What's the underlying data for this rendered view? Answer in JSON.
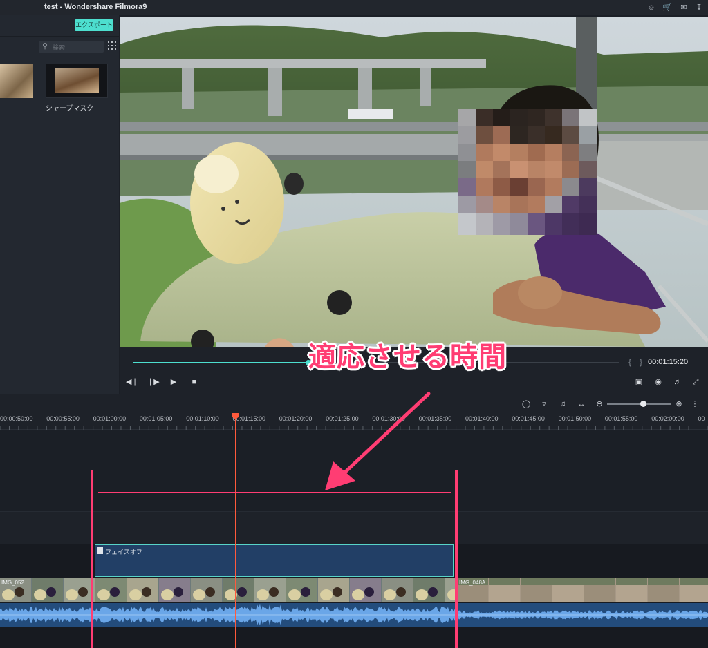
{
  "window": {
    "title": "test - Wondershare Filmora9"
  },
  "titlebar_icons": [
    "account-icon",
    "cart-icon",
    "mail-icon",
    "download-icon"
  ],
  "media_panel": {
    "export_label": "エクスポート",
    "search_placeholder": "検索",
    "items": [
      {
        "label": ""
      },
      {
        "label": "シャープマスク"
      }
    ]
  },
  "player": {
    "progress": 0.36,
    "timecode": "00:01:15:20",
    "mark_in": "{",
    "mark_out": "}"
  },
  "timeline": {
    "zoom_level": 0.57,
    "ruler_labels": [
      "00:00:50:00",
      "00:00:55:00",
      "00:01:00:00",
      "00:01:05:00",
      "00:01:10:00",
      "00:01:15:00",
      "00:01:20:00",
      "00:01:25:00",
      "00:01:30:00",
      "00:01:35:00",
      "00:01:40:00",
      "00:01:45:00",
      "00:01:50:00",
      "00:01:55:00",
      "00:02:00:00",
      "00"
    ],
    "effect_clip_label": "フェイスオフ",
    "video_clips": [
      {
        "name": "IMG_052"
      },
      {
        "name": "IMG_048A"
      }
    ]
  },
  "annotation": {
    "callout": "適応させる時間"
  },
  "colors": {
    "accent": "#4ddfcf",
    "playhead": "#ff5a3c",
    "annotation": "#ff3d73",
    "effect_clip": "#223f66",
    "audio_track": "#234c7c"
  }
}
